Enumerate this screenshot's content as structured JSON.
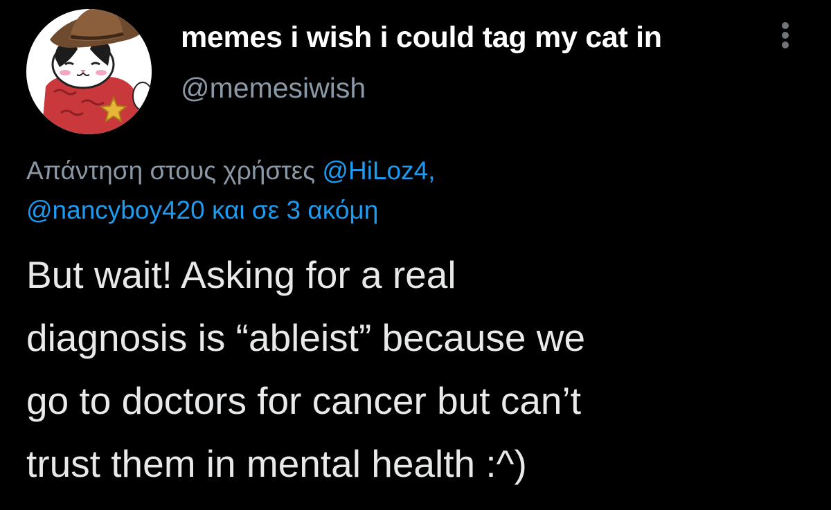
{
  "tweet": {
    "author": {
      "display_name": "memes i wish i could tag my cat in",
      "handle": "@memesiwish",
      "avatar_icon": "cowboy-cat-avatar"
    },
    "menu_icon": "more-vertical-icon",
    "reply_context": {
      "prefix": "Απάντηση στους χρήστες ",
      "mention_1": "@HiLoz4",
      "separator": ",",
      "mention_2": "@nancyboy420",
      "suffix_link": " και σε 3 ακόμη"
    },
    "text": "But wait! Asking for a real\ndiagnosis is “ableist” because we\ngo to doctors for cancer but can’t\ntrust them in mental health :^)"
  },
  "colors": {
    "background": "#000000",
    "name": "#ffffff",
    "handle": "#8b98a5",
    "body_text": "#e7e9ea",
    "link": "#1d9bf0",
    "icon": "#71767b"
  }
}
